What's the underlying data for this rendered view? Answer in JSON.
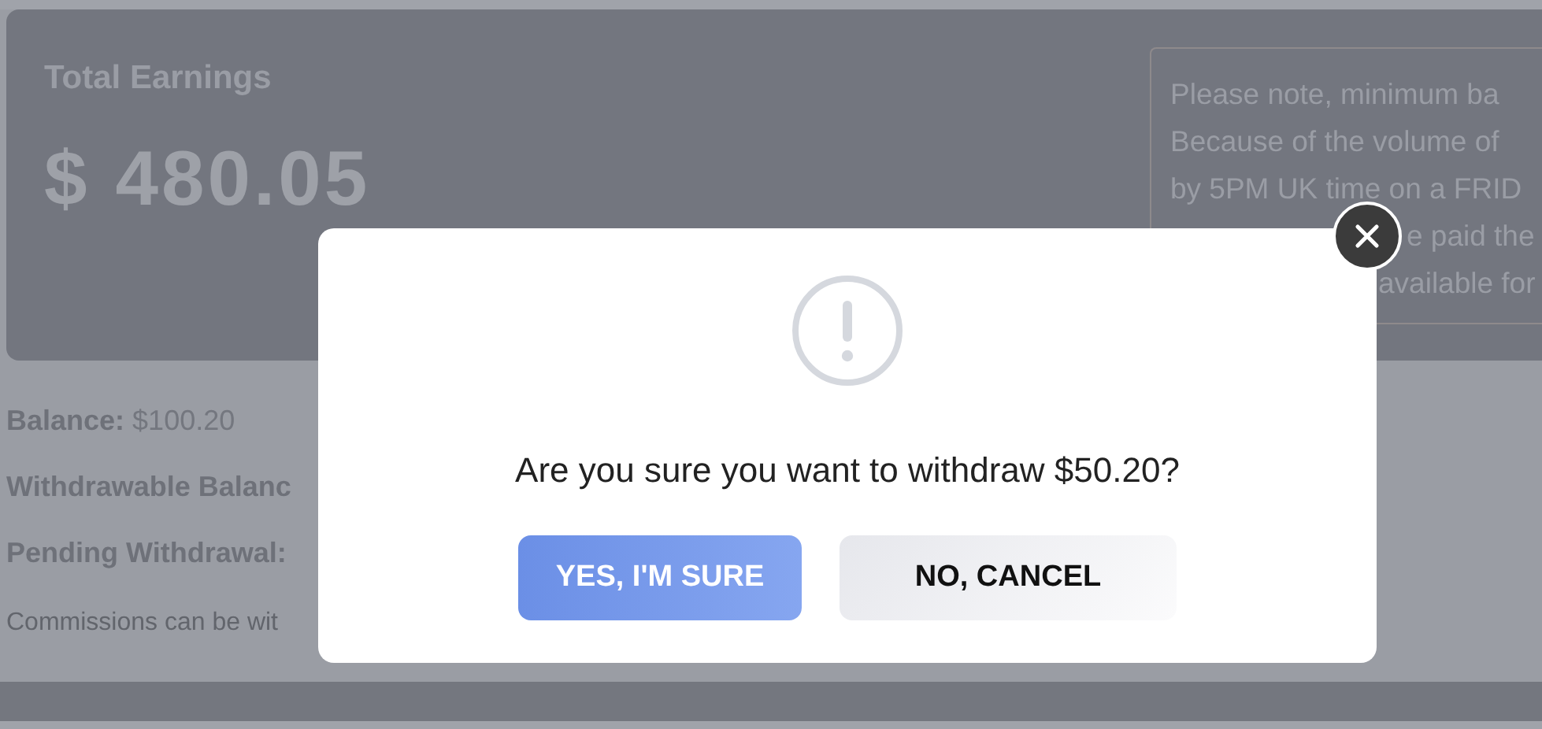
{
  "earnings": {
    "title": "Total Earnings",
    "currency": "$",
    "amount": "480.05"
  },
  "note": {
    "lines": [
      "Please note, minimum ba",
      "Because of the volume of",
      "by 5PM UK time on a FRID",
      "e paid the",
      "available for"
    ]
  },
  "details": [
    {
      "label": "Balance:",
      "value": "$100.20"
    },
    {
      "label": "Withdrawable Balanc"
    },
    {
      "label": "Pending Withdrawal:"
    }
  ],
  "footnote": "Commissions can be wit",
  "dialog": {
    "message": "Are you sure you want to withdraw $50.20?",
    "buttons": [
      {
        "label": "YES, I'M SURE",
        "kind": "confirm"
      },
      {
        "label": "NO, CANCEL",
        "kind": "cancel"
      }
    ]
  }
}
